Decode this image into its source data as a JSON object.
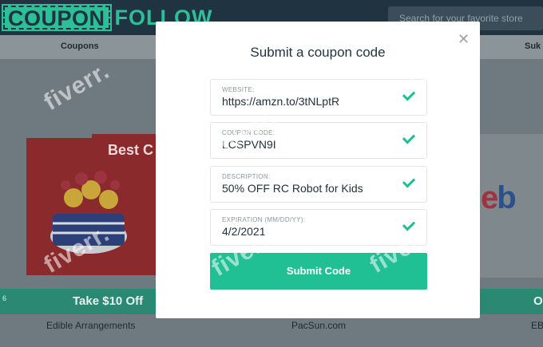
{
  "header": {
    "logo_part1": "COUPON",
    "logo_part2": "FOLLOW",
    "search_placeholder": "Search for your favorite store"
  },
  "nav": {
    "coupons_label": "Coupons",
    "right_label": "Suk"
  },
  "background_cards": [
    {
      "tag": "Best C",
      "offer": "Take $10 Off",
      "store": "Edible Arrangements"
    },
    {
      "offer": "",
      "store": "PacSun.com"
    },
    {
      "logo": "eb",
      "offer": "O",
      "store": "EB"
    }
  ],
  "side_tab_text": "6",
  "modal": {
    "title": "Submit a coupon code",
    "close_icon": "close-icon",
    "fields": [
      {
        "label": "WEBSITE:",
        "value": "https://amzn.to/3tNLptR"
      },
      {
        "label": "COUPON CODE:",
        "value": "LCSPVN9I"
      },
      {
        "label": "DESCRIPTION:",
        "value": "50% OFF RC Robot for Kids"
      },
      {
        "label": "EXPIRATION (MM/DD/YY):",
        "value": "4/2/2021"
      }
    ],
    "submit_label": "Submit Code"
  },
  "watermark": "fiverr.",
  "colors": {
    "accent": "#20bf94",
    "topbar": "#1f3340",
    "modal_bg": "#ffffff"
  }
}
